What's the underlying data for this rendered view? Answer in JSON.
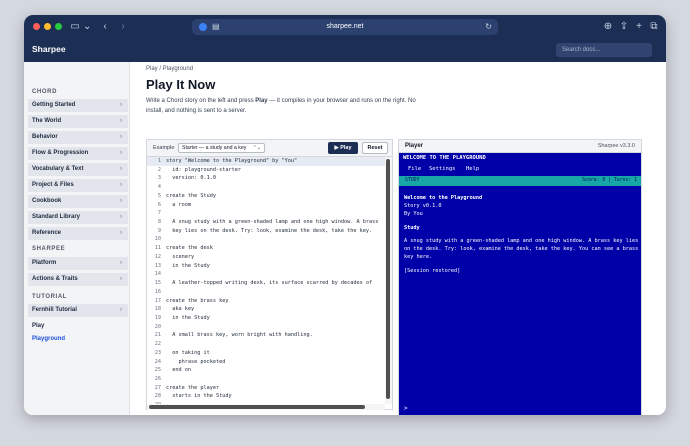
{
  "browser": {
    "url": "sharpee.net"
  },
  "header": {
    "brand": "Sharpee",
    "search_placeholder": "Search docs..."
  },
  "sidebar": {
    "sections": [
      {
        "title": "CHORD",
        "items": [
          {
            "label": "Getting Started",
            "has_chevron": true
          },
          {
            "label": "The World",
            "has_chevron": true
          },
          {
            "label": "Behavior",
            "has_chevron": true
          },
          {
            "label": "Flow & Progression",
            "has_chevron": true
          },
          {
            "label": "Vocabulary & Text",
            "has_chevron": true
          },
          {
            "label": "Project & Files",
            "has_chevron": true
          },
          {
            "label": "Cookbook",
            "has_chevron": true
          },
          {
            "label": "Standard Library",
            "has_chevron": true
          },
          {
            "label": "Reference",
            "has_chevron": true
          }
        ]
      },
      {
        "title": "SHARPEE",
        "items": [
          {
            "label": "Platform",
            "has_chevron": true
          },
          {
            "label": "Actions & Traits",
            "has_chevron": true
          }
        ]
      },
      {
        "title": "TUTORIAL",
        "items": [
          {
            "label": "Fernhill Tutorial",
            "has_chevron": true
          },
          {
            "label": "Play",
            "has_chevron": false
          },
          {
            "label": "Playground",
            "has_chevron": false,
            "active": true
          }
        ]
      }
    ]
  },
  "main": {
    "breadcrumb": "Play / Playground",
    "title": "Play It Now",
    "desc_before": "Write a Chord story on the left and press ",
    "desc_bold": "Play",
    "desc_after": " — it compiles in your browser and runs on the right. No install, and nothing is sent to a server."
  },
  "editor": {
    "example_label": "Example",
    "example_value": "Starter — a study and a key",
    "play_label": "▶ Play",
    "reset_label": "Reset",
    "lines": [
      "story \"Welcome to the Playground\" by \"You\"",
      "  id: playground-starter",
      "  version: 0.1.0",
      "",
      "create the Study",
      "  a room",
      "",
      "  A snug study with a green-shaded lamp and one high window. A brass",
      "  key lies on the desk. Try: look, examine the desk, take the key.",
      "",
      "create the desk",
      "  scenery",
      "  in the Study",
      "",
      "  A leather-topped writing desk, its surface scarred by decades of",
      "",
      "create the brass key",
      "  aka key",
      "  in the Study",
      "",
      "  A small brass key, worn bright with handling.",
      "",
      "  on taking it",
      "    phrase pocketed",
      "  end on",
      "",
      "create the player",
      "  starts in the Study",
      ""
    ]
  },
  "player": {
    "title": "Player",
    "version": "Sharpee v3.3.0",
    "screen_title": "WELCOME TO THE PLAYGROUND",
    "menu": [
      "File",
      "Settings",
      "Help"
    ],
    "status_location": "STUDY",
    "status_score": "Score: 0 | Turns: 1",
    "output": {
      "story_title": "Welcome to the Playground",
      "story_version": "Story v0.1.0",
      "story_author": "By You",
      "room_name": "Study",
      "room_desc": "A snug study with a green-shaded lamp and one high window. A brass key lies on the desk. Try: look, examine the desk, take the key. You can see a brass key here.",
      "restored": "[Session restored]"
    },
    "prompt": ">"
  },
  "colors": {
    "navy": "#1c2e54",
    "screen_blue": "#0000a8",
    "status_teal": "#18a6a6",
    "link_blue": "#1d4ed8"
  }
}
